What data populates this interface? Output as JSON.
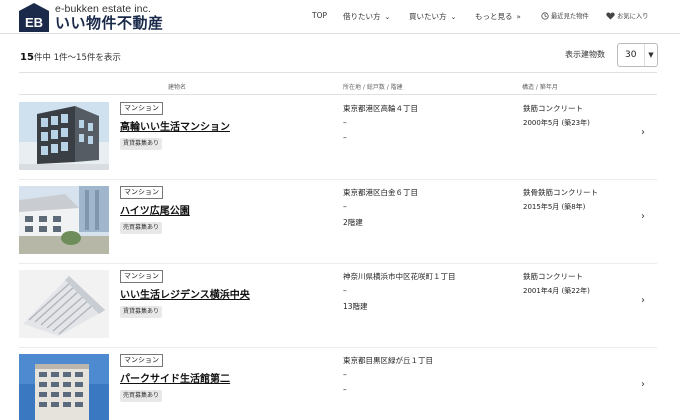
{
  "brand": {
    "logo_mark": "EB",
    "sub": "e-bukken estate inc.",
    "main": "いい物件不動産"
  },
  "nav": {
    "top": "TOP",
    "rent": "借りたい方",
    "buy": "買いたい方",
    "more": "もっと見る",
    "recent": "最近見た物件",
    "favorites": "お気に入り"
  },
  "summary": {
    "total": "15",
    "suffix": "件中 1件〜15件を表示"
  },
  "sort": {
    "label": "表示建物数",
    "value": "30"
  },
  "columns": {
    "name": "建物名",
    "location": "所在地 / 総戸数 / 階建",
    "structure": "構造 / 築年月"
  },
  "listings": [
    {
      "type": "マンション",
      "name": "高輪いい生活マンション",
      "status": "賃貸募集あり",
      "address": "東京都港区高輪４丁目",
      "units": "–",
      "floors": "–",
      "structure": "鉄筋コンクリート",
      "built": "2000年5月 (築23年)"
    },
    {
      "type": "マンション",
      "name": "ハイツ広尾公園",
      "status": "売買募集あり",
      "address": "東京都港区白金６丁目",
      "units": "–",
      "floors": "2階建",
      "structure": "鉄骨鉄筋コンクリート",
      "built": "2015年5月 (築8年)"
    },
    {
      "type": "マンション",
      "name": "いい生活レジデンス横浜中央",
      "status": "賃貸募集あり",
      "address": "神奈川県横浜市中区花咲町１丁目",
      "units": "–",
      "floors": "13階建",
      "structure": "鉄筋コンクリート",
      "built": "2001年4月 (築22年)"
    },
    {
      "type": "マンション",
      "name": "パークサイド生活館第二",
      "status": "売買募集あり",
      "address": "東京都目黒区緑が丘１丁目",
      "units": "–",
      "floors": "–",
      "structure": "",
      "built": ""
    }
  ],
  "icons": {
    "chevron": "chevron-right-icon",
    "caret": "chevron-down-icon",
    "recent": "history-icon",
    "favorite": "heart-icon"
  },
  "colors": {
    "brand": "#1b2a4a",
    "text": "#222222",
    "badge_bg": "#e8e8e8"
  }
}
